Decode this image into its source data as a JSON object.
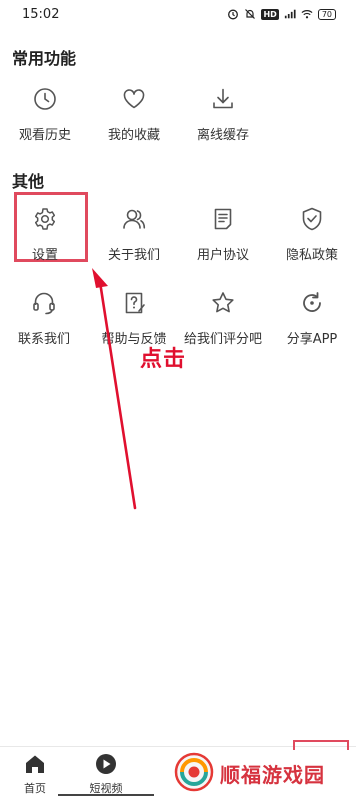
{
  "status_bar": {
    "time": "15:02",
    "hd": "HD",
    "battery": "70",
    "icons": [
      "alarm-icon",
      "bell-off-icon",
      "hd-icon",
      "signal-icon",
      "wifi-icon",
      "battery-icon"
    ]
  },
  "common": {
    "title": "常用功能",
    "items": [
      {
        "label": "观看历史",
        "icon": "clock-icon"
      },
      {
        "label": "我的收藏",
        "icon": "heart-icon"
      },
      {
        "label": "离线缓存",
        "icon": "download-icon"
      }
    ]
  },
  "other": {
    "title": "其他",
    "items": [
      {
        "label": "设置",
        "icon": "gear-icon"
      },
      {
        "label": "关于我们",
        "icon": "users-icon"
      },
      {
        "label": "用户协议",
        "icon": "document-icon"
      },
      {
        "label": "隐私政策",
        "icon": "shield-check-icon"
      },
      {
        "label": "联系我们",
        "icon": "headset-icon"
      },
      {
        "label": "帮助与反馈",
        "icon": "help-feedback-icon"
      },
      {
        "label": "给我们评分吧",
        "icon": "star-icon"
      },
      {
        "label": "分享APP",
        "icon": "share-refresh-icon"
      }
    ]
  },
  "annotation": {
    "text": "点击",
    "color": "#e0102f"
  },
  "bottom_nav": {
    "tabs": [
      {
        "label": "首页",
        "icon": "home-icon"
      },
      {
        "label": "短视频",
        "icon": "play-circle-icon"
      }
    ]
  },
  "watermark": {
    "text": "顺福游戏园"
  },
  "colors": {
    "highlight": "#e04a5e",
    "text": "#333333",
    "icon_stroke": "#555555"
  }
}
